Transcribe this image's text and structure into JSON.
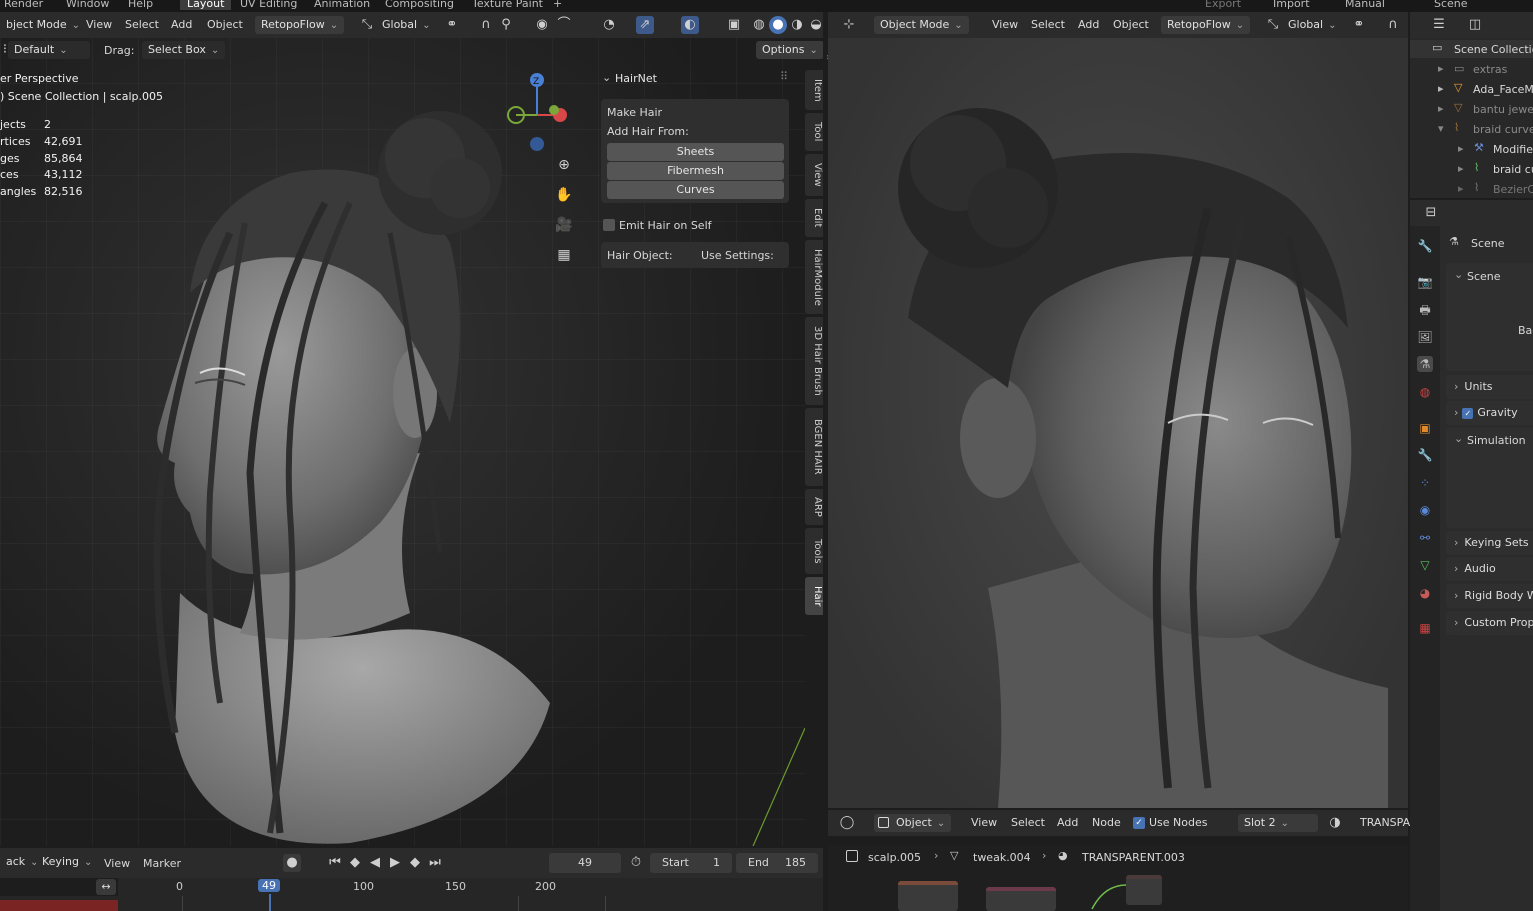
{
  "menubar": [
    "Render",
    "Window",
    "Help",
    "Layout",
    "UV Editing",
    "Animation",
    "Compositing",
    "Texture Paint",
    "Export",
    "Import",
    "Manual",
    "Scene"
  ],
  "left_header": {
    "mode": "bject Mode",
    "menus": [
      "View",
      "Select",
      "Add",
      "Object"
    ],
    "retopo": "RetopoFlow",
    "transform": "Global"
  },
  "tool_header": {
    "preset": "Default",
    "drag_label": "Drag:",
    "drag_value": "Select Box",
    "options": "Options"
  },
  "viewport": {
    "view_name": "er Perspective",
    "collection": ") Scene Collection | scalp.005",
    "stats": [
      {
        "label": "jects",
        "value": "2"
      },
      {
        "label": "rtices",
        "value": "42,691"
      },
      {
        "label": "ges",
        "value": "85,864"
      },
      {
        "label": "ces",
        "value": "43,112"
      },
      {
        "label": "angles",
        "value": "82,516"
      }
    ],
    "gizmo_z": "Z"
  },
  "hairnet": {
    "title": "HairNet",
    "make_hair": "Make Hair",
    "add_from": "Add Hair From:",
    "buttons": [
      "Sheets",
      "Fibermesh",
      "Curves"
    ],
    "emit_label": "Emit Hair on Self",
    "hair_object_label": "Hair Object:",
    "use_settings_label": "Use Settings:"
  },
  "sidebar_tabs": [
    "Item",
    "Tool",
    "View",
    "Edit",
    "HairModule",
    "3D Hair Brush",
    "BGEN HAIR",
    "ARP",
    "Tools",
    "Hair"
  ],
  "right_header": {
    "mode": "Object Mode",
    "menus": [
      "View",
      "Select",
      "Add",
      "Object"
    ],
    "retopo": "RetopoFlow",
    "transform": "Global"
  },
  "node_header": {
    "type": "Object",
    "menus": [
      "View",
      "Select",
      "Add",
      "Node"
    ],
    "use_nodes": "Use Nodes",
    "slot": "Slot 2",
    "material": "TRANSPA"
  },
  "breadcrumb": [
    "scalp.005",
    "tweak.004",
    "TRANSPARENT.003"
  ],
  "timeline": {
    "playback": "ack",
    "keying": "Keying",
    "menus": [
      "View",
      "Marker"
    ],
    "current_frame": "49",
    "start_label": "Start",
    "start_value": "1",
    "end_label": "End",
    "end_value": "185",
    "ruler": [
      "0",
      "49",
      "100",
      "150",
      "200"
    ]
  },
  "outliner": {
    "items": [
      "Scene Collectio",
      "extras",
      "Ada_FaceM",
      "bantu jewel",
      "braid curve",
      "Modifie",
      "braid cu",
      "BezierC"
    ]
  },
  "properties": {
    "tab": "Scene",
    "section": "Scene",
    "background": "Backgro",
    "rows": [
      "Units",
      "Gravity",
      "Simulation",
      "Keying Sets",
      "Audio",
      "Rigid Body W",
      "Custom Prop"
    ]
  },
  "colors": {
    "accent_blue": "#4772b3",
    "header": "#2b2b2b",
    "viewport": "#3c3c3c",
    "frame_marker": "#4772b3"
  }
}
